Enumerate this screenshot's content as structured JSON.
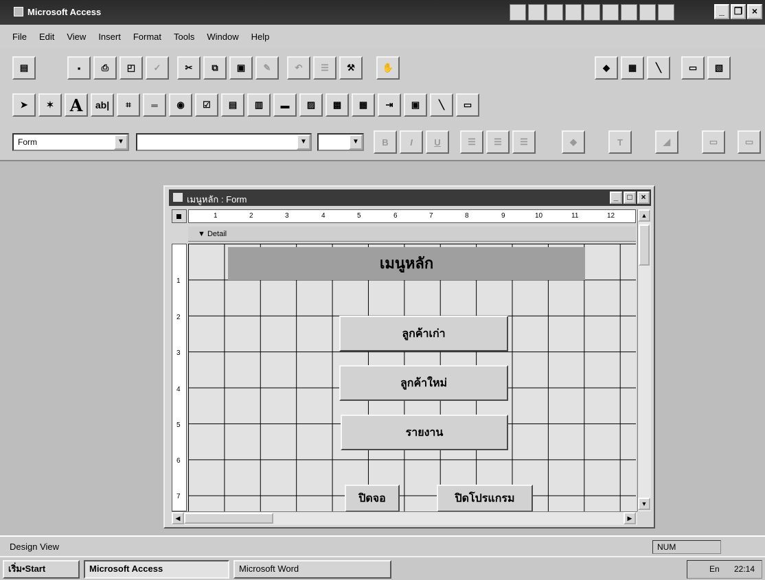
{
  "window": {
    "title": "Microsoft Access"
  },
  "menu": [
    "File",
    "Edit",
    "View",
    "Insert",
    "Format",
    "Tools",
    "Window",
    "Help"
  ],
  "format_toolbar": {
    "object_select": "Form",
    "font_select": "",
    "size_select": ""
  },
  "toolbox": {
    "label_tool": "A",
    "textbox_tool": "ab|"
  },
  "form_window": {
    "title": "เมนูหลัก : Form",
    "ruler_marks": [
      "1",
      "2",
      "3",
      "4",
      "5",
      "6",
      "7",
      "8",
      "9",
      "10",
      "11",
      "12"
    ],
    "vruler_marks": [
      "1",
      "2",
      "3",
      "4",
      "5",
      "6",
      "7"
    ],
    "section": "Detail",
    "header_label": "เมนูหลัก",
    "buttons": {
      "old_customer": "ลูกค้าเก่า",
      "new_customer": "ลูกค้าใหม่",
      "report": "รายงาน",
      "close_screen": "ปิดจอ",
      "close_program": "ปิดโปรแกรม"
    }
  },
  "status": {
    "mode": "Design View",
    "num": "NUM"
  },
  "taskbar": {
    "start": "เริ่ม•Start",
    "items": [
      "Microsoft Access",
      "Microsoft Word"
    ],
    "clock": "22:14",
    "lang": "En"
  }
}
